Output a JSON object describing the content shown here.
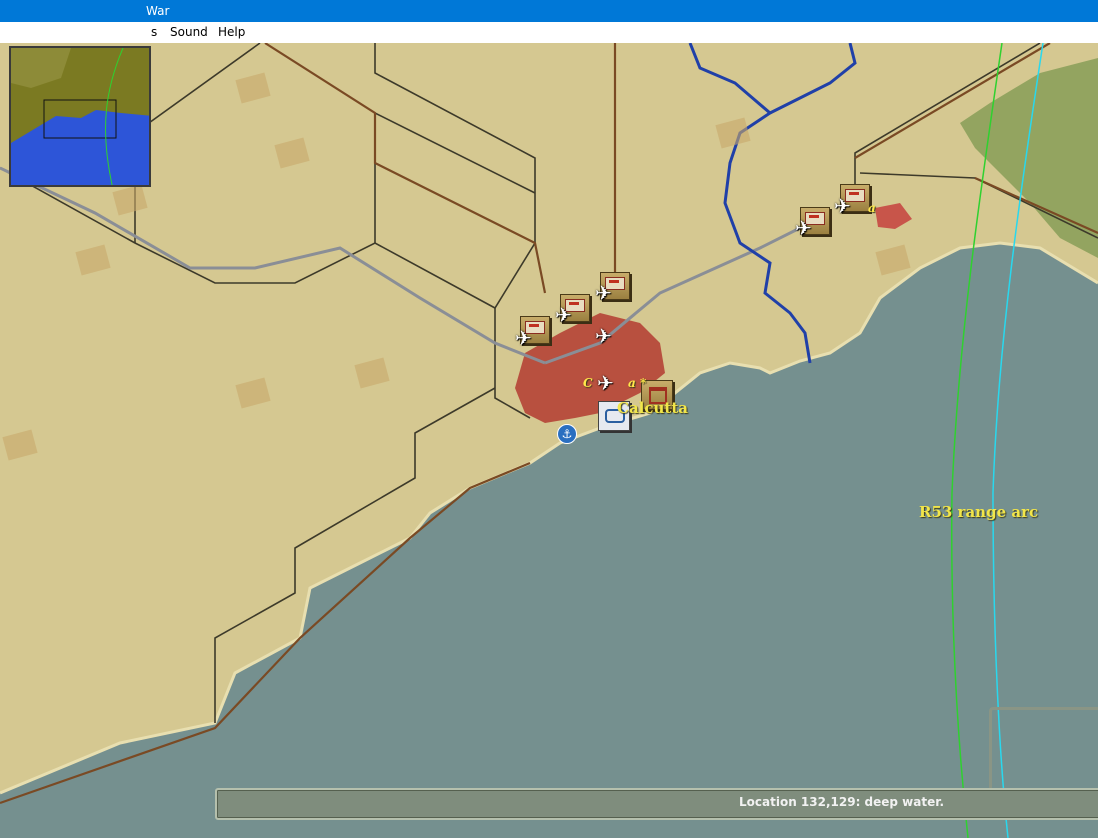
{
  "window": {
    "title": "War"
  },
  "menu": {
    "items": [
      "s",
      "Sound",
      "Help"
    ]
  },
  "map": {
    "labels": {
      "calcutta": "Calcutta",
      "calcutta_base_fragment_left": "C",
      "calcutta_base_fragment_right": "a *",
      "other_base_fragment": "a",
      "range_arc": "R53 range arc"
    },
    "colors": {
      "land": "#d5c891",
      "water": "#75908f",
      "city": "#b8503f",
      "arc_green": "#2fd12f",
      "arc_cyan": "#29d8ee",
      "label": "#f2e64a"
    }
  },
  "status": {
    "text": "Location 132,129: deep water."
  }
}
